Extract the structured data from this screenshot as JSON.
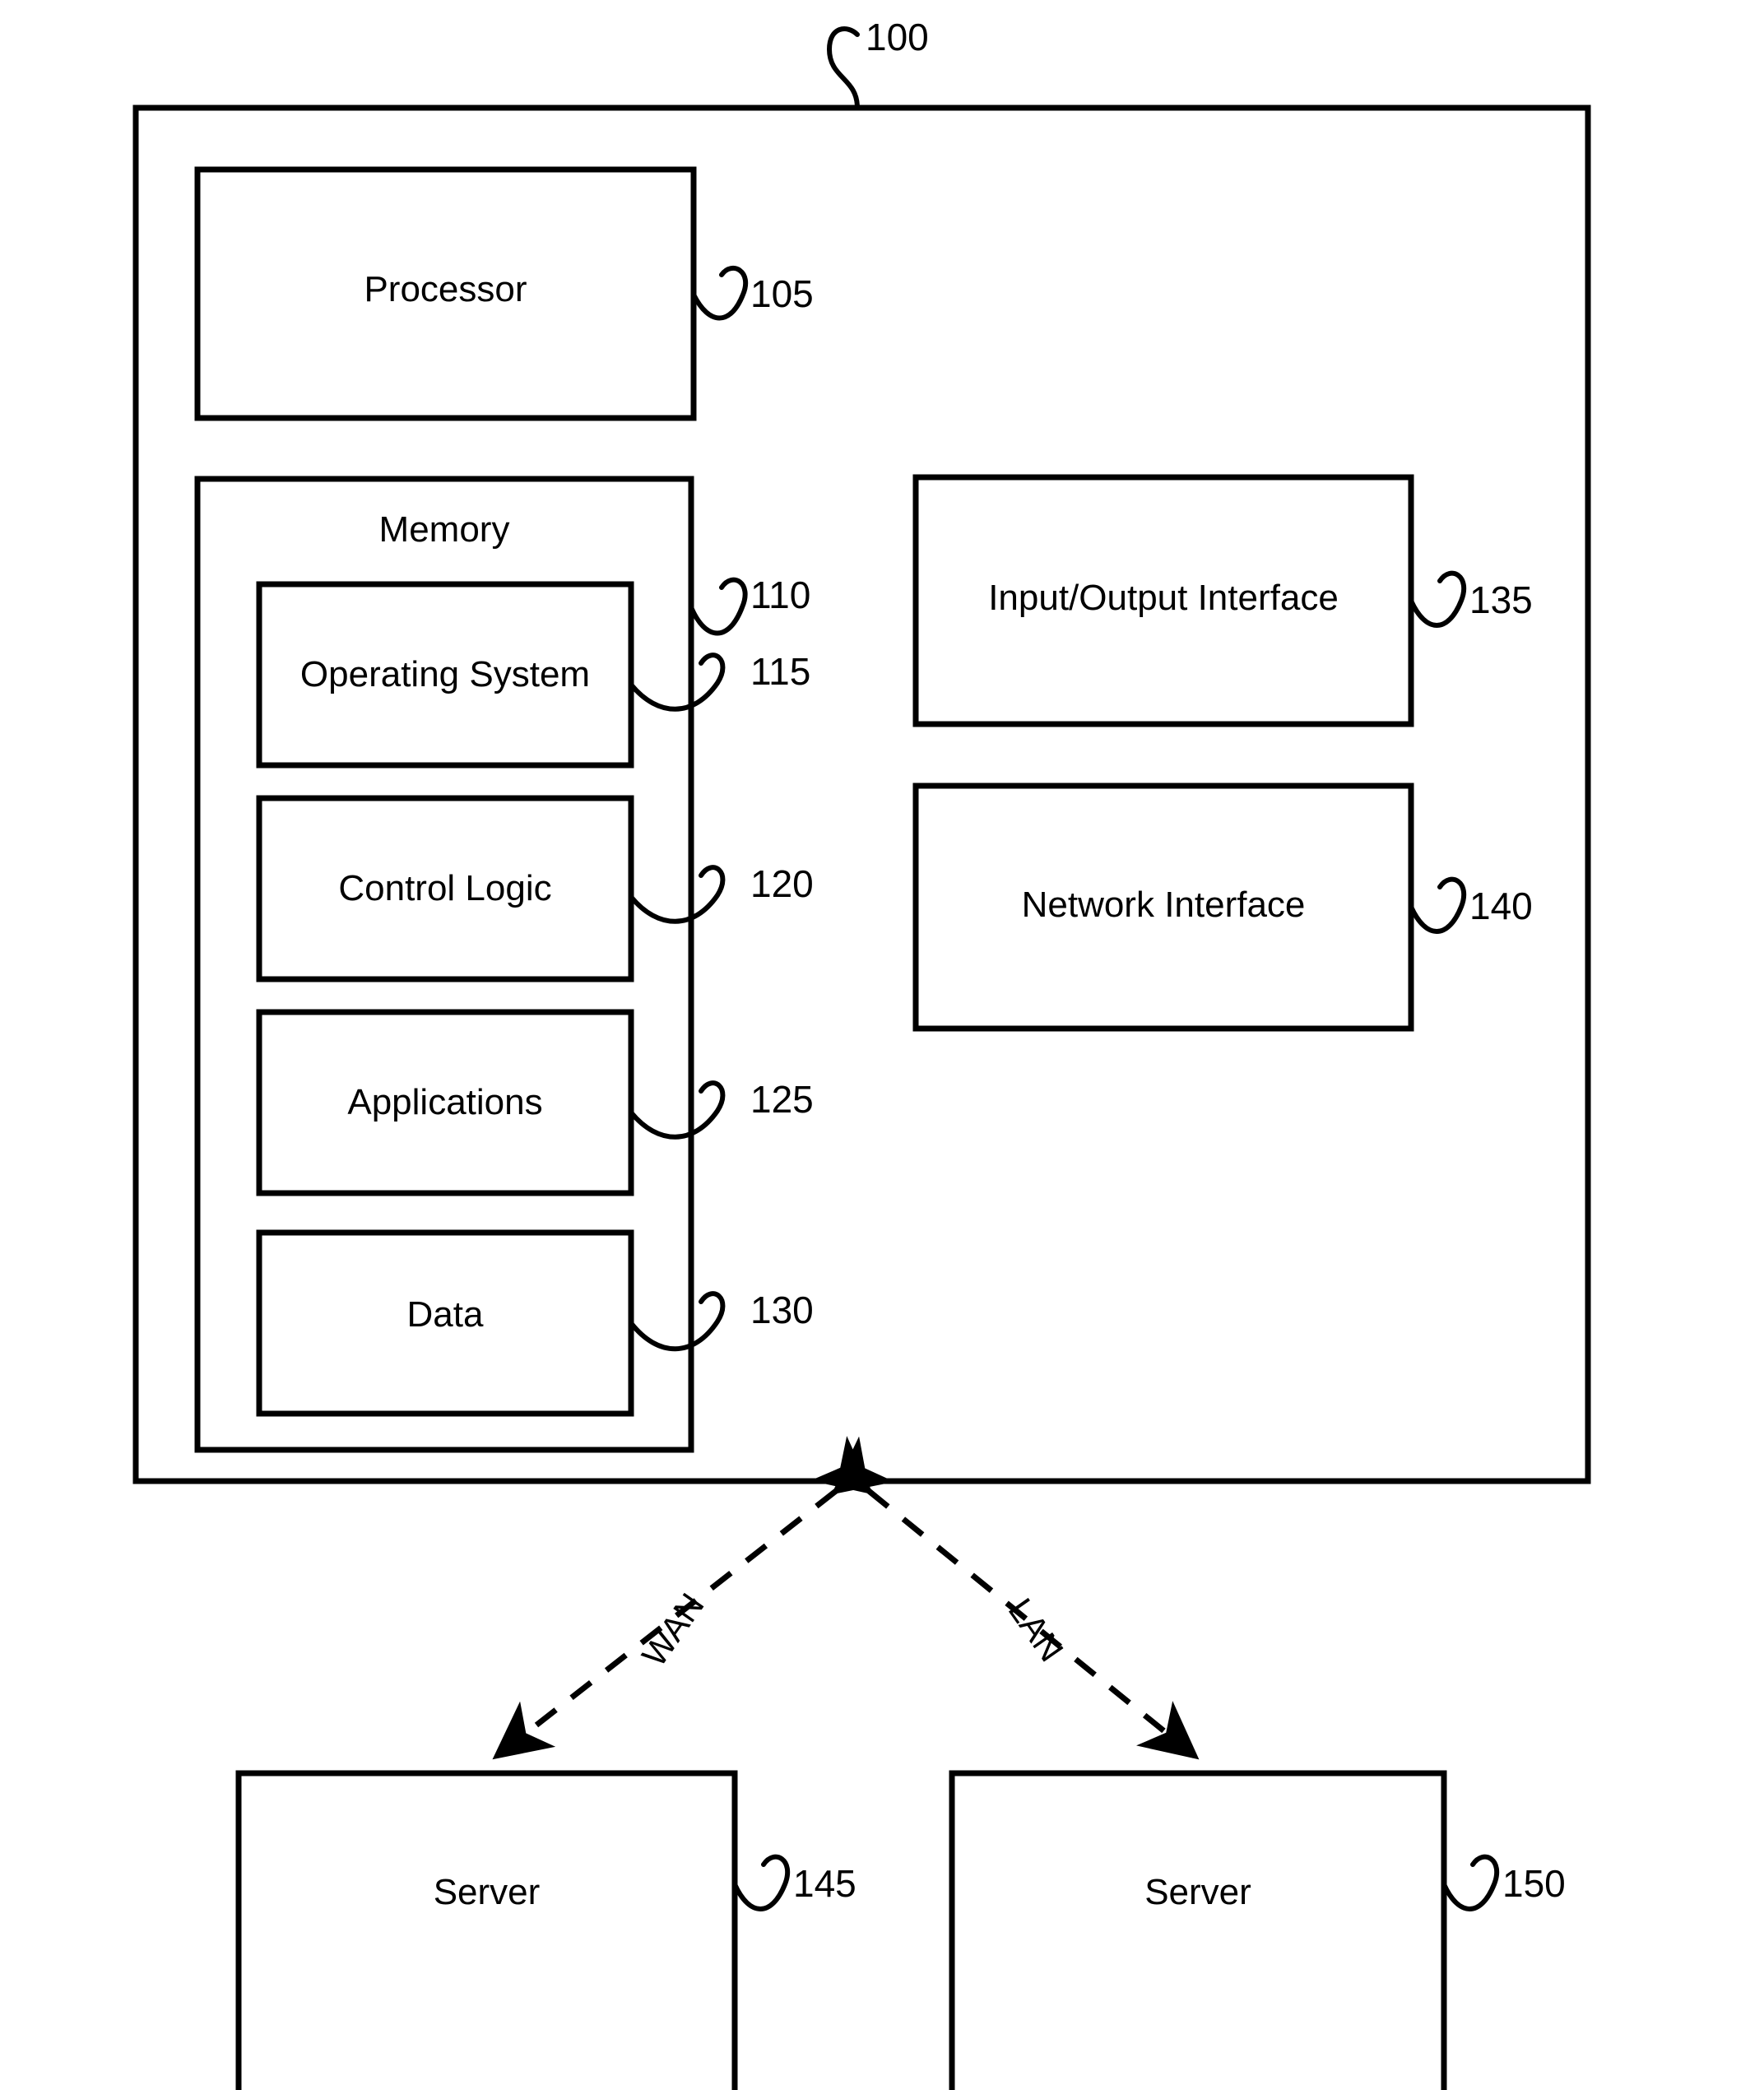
{
  "figure": {
    "reference_number": "100",
    "system_box": {
      "name": "computing-device",
      "children_refs": [
        "105",
        "110",
        "115",
        "120",
        "125",
        "130",
        "135",
        "140"
      ]
    },
    "blocks": [
      {
        "id": "processor",
        "label": "Processor",
        "ref": "105"
      },
      {
        "id": "memory",
        "label": "Memory",
        "ref": "110"
      },
      {
        "id": "operating-system",
        "label": "Operating System",
        "ref": "115"
      },
      {
        "id": "control-logic",
        "label": "Control Logic",
        "ref": "120"
      },
      {
        "id": "applications",
        "label": "Applications",
        "ref": "125"
      },
      {
        "id": "data",
        "label": "Data",
        "ref": "130"
      },
      {
        "id": "io-interface",
        "label": "Input/Output Interface",
        "ref": "135"
      },
      {
        "id": "network-interface",
        "label": "Network Interface",
        "ref": "140"
      },
      {
        "id": "server-wan",
        "label": "Server",
        "ref": "145"
      },
      {
        "id": "server-lan",
        "label": "Server",
        "ref": "150"
      }
    ],
    "connections": [
      {
        "id": "wan-link",
        "label": "WAN",
        "from": "computing-device",
        "to": "server-wan",
        "style": "dashed",
        "arrows": "both"
      },
      {
        "id": "lan-link",
        "label": "LAN",
        "from": "computing-device",
        "to": "server-lan",
        "style": "dashed",
        "arrows": "both"
      }
    ],
    "colors": {
      "stroke": "#000000",
      "background": "#ffffff",
      "text": "#000000"
    }
  }
}
